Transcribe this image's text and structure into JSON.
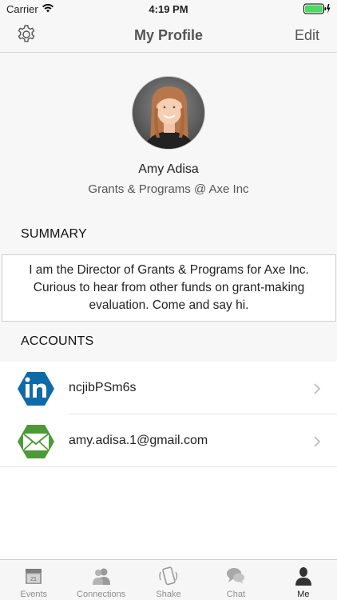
{
  "status_bar": {
    "carrier": "Carrier",
    "time": "4:19 PM"
  },
  "nav": {
    "title": "My Profile",
    "edit_label": "Edit",
    "settings_icon": "gear-icon"
  },
  "profile": {
    "name": "Amy Adisa",
    "role": "Grants & Programs @ Axe Inc"
  },
  "summary": {
    "title": "SUMMARY",
    "text": "I am the Director of Grants & Programs for Axe Inc. Curious to hear from other funds on grant-making evaluation. Come and say hi."
  },
  "accounts": {
    "title": "ACCOUNTS",
    "items": [
      {
        "icon": "linkedin-icon",
        "label": "ncjibPSm6s",
        "color": "#0f6aa8"
      },
      {
        "icon": "mail-icon",
        "label": "amy.adisa.1@gmail.com",
        "color": "#4c9a36"
      }
    ]
  },
  "tabs": [
    {
      "label": "Events",
      "icon": "calendar-icon",
      "badge": "21"
    },
    {
      "label": "Connections",
      "icon": "people-icon"
    },
    {
      "label": "Shake",
      "icon": "phone-shake-icon"
    },
    {
      "label": "Chat",
      "icon": "chat-icon"
    },
    {
      "label": "Me",
      "icon": "person-icon",
      "active": true
    }
  ],
  "colors": {
    "battery": "#4cd964",
    "tab_inactive": "#8e8e8e",
    "tab_active": "#222222"
  }
}
